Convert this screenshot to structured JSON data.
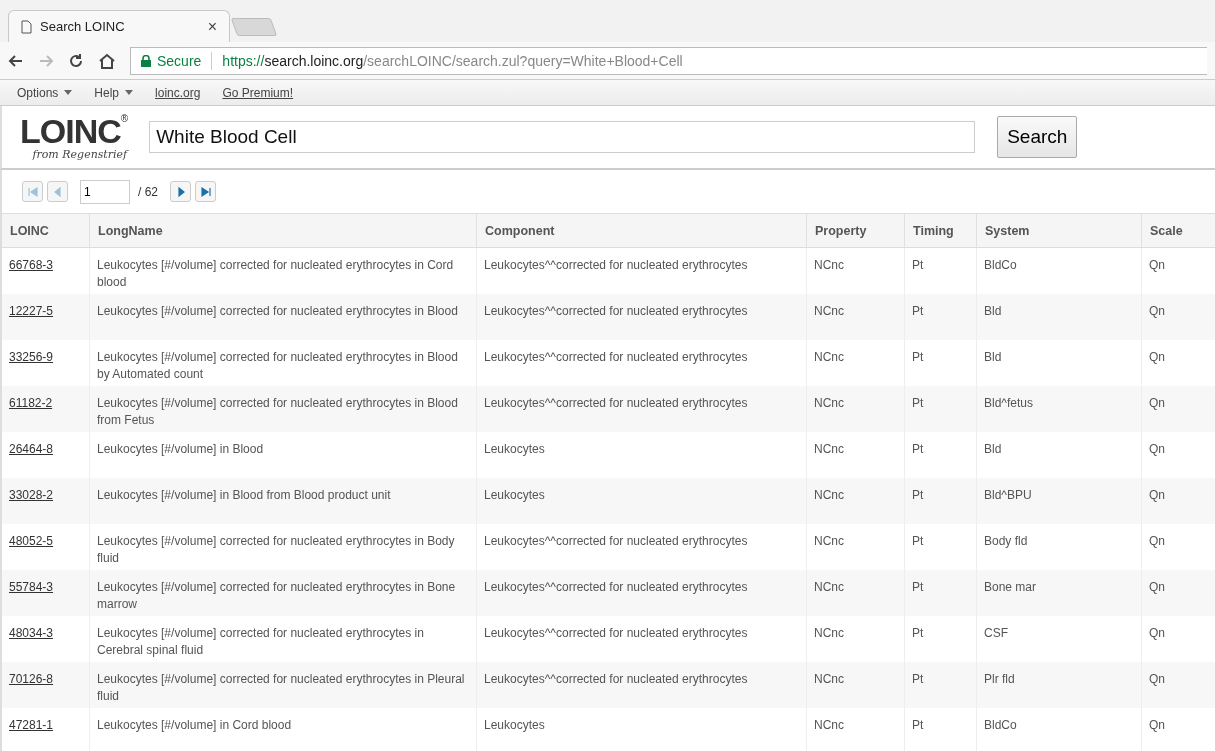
{
  "browser": {
    "tab_title": "Search LOINC",
    "tab_close": "×",
    "secure_label": "Secure",
    "url_scheme": "https://",
    "url_host": "search.loinc.org",
    "url_path": "/searchLOINC/search.zul?query=White+Blood+Cell"
  },
  "menu": [
    {
      "label": "Options",
      "kind": "dropdown"
    },
    {
      "label": "Help",
      "kind": "dropdown"
    },
    {
      "label": "loinc.org",
      "kind": "link"
    },
    {
      "label": "Go Premium!",
      "kind": "link"
    }
  ],
  "logo": {
    "text": "LOINC",
    "mark": "®",
    "tagline": "from Regenstrief"
  },
  "search": {
    "value": "White Blood Cell",
    "button": "Search"
  },
  "pager": {
    "page": "1",
    "total": "/ 62"
  },
  "table": {
    "columns": [
      "LOINC",
      "LongName",
      "Component",
      "Property",
      "Timing",
      "System",
      "Scale"
    ],
    "rows": [
      [
        "66768-3",
        "Leukocytes [#/volume] corrected for nucleated erythrocytes in Cord blood",
        "Leukocytes^^corrected for nucleated erythrocytes",
        "NCnc",
        "Pt",
        "BldCo",
        "Qn"
      ],
      [
        "12227-5",
        "Leukocytes [#/volume] corrected for nucleated erythrocytes in Blood",
        "Leukocytes^^corrected for nucleated erythrocytes",
        "NCnc",
        "Pt",
        "Bld",
        "Qn"
      ],
      [
        "33256-9",
        "Leukocytes [#/volume] corrected for nucleated erythrocytes in Blood by Automated count",
        "Leukocytes^^corrected for nucleated erythrocytes",
        "NCnc",
        "Pt",
        "Bld",
        "Qn"
      ],
      [
        "61182-2",
        "Leukocytes [#/volume] corrected for nucleated erythrocytes in Blood from Fetus",
        "Leukocytes^^corrected for nucleated erythrocytes",
        "NCnc",
        "Pt",
        "Bld^fetus",
        "Qn"
      ],
      [
        "26464-8",
        "Leukocytes [#/volume] in Blood",
        "Leukocytes",
        "NCnc",
        "Pt",
        "Bld",
        "Qn"
      ],
      [
        "33028-2",
        "Leukocytes [#/volume] in Blood from Blood product unit",
        "Leukocytes",
        "NCnc",
        "Pt",
        "Bld^BPU",
        "Qn"
      ],
      [
        "48052-5",
        "Leukocytes [#/volume] corrected for nucleated erythrocytes in Body fluid",
        "Leukocytes^^corrected for nucleated erythrocytes",
        "NCnc",
        "Pt",
        "Body fld",
        "Qn"
      ],
      [
        "55784-3",
        "Leukocytes [#/volume] corrected for nucleated erythrocytes in Bone marrow",
        "Leukocytes^^corrected for nucleated erythrocytes",
        "NCnc",
        "Pt",
        "Bone mar",
        "Qn"
      ],
      [
        "48034-3",
        "Leukocytes [#/volume] corrected for nucleated erythrocytes in Cerebral spinal fluid",
        "Leukocytes^^corrected for nucleated erythrocytes",
        "NCnc",
        "Pt",
        "CSF",
        "Qn"
      ],
      [
        "70126-8",
        "Leukocytes [#/volume] corrected for nucleated erythrocytes in Pleural fluid",
        "Leukocytes^^corrected for nucleated erythrocytes",
        "NCnc",
        "Pt",
        "Plr fld",
        "Qn"
      ],
      [
        "47281-1",
        "Leukocytes [#/volume] in Cord blood",
        "Leukocytes",
        "NCnc",
        "Pt",
        "BldCo",
        "Qn"
      ]
    ]
  }
}
